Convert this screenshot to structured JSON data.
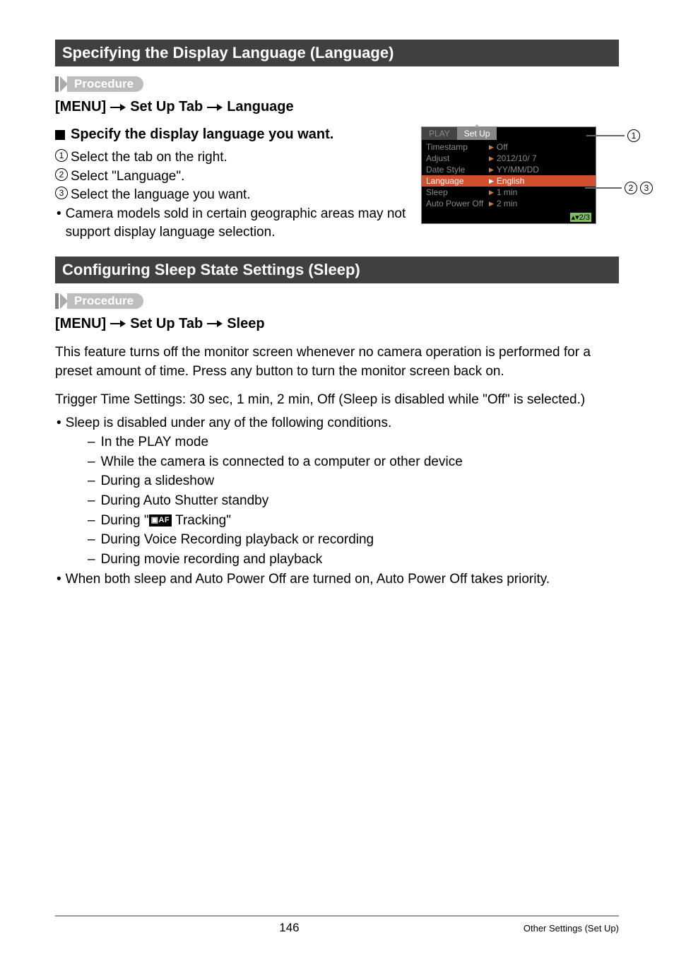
{
  "section1": {
    "title": "Specifying the Display Language (Language)",
    "procedure_label": "Procedure",
    "menu_path": {
      "a": "[MENU]",
      "b": "Set Up Tab",
      "c": "Language"
    },
    "subheading": "Specify the display language you want.",
    "steps": {
      "s1": "Select the tab on the right.",
      "s2": "Select \"Language\".",
      "s3": "Select the language you want."
    },
    "note": "Camera models sold in certain geographic areas may not support display language selection."
  },
  "camera": {
    "tab_play": "PLAY",
    "tab_setup": "Set Up",
    "rows": [
      {
        "k": "Timestamp",
        "v": "Off"
      },
      {
        "k": "Adjust",
        "v": "2012/10/ 7"
      },
      {
        "k": "Date Style",
        "v": "YY/MM/DD"
      },
      {
        "k": "Language",
        "v": "English",
        "hl": true
      },
      {
        "k": "Sleep",
        "v": "1 min"
      },
      {
        "k": "Auto Power Off",
        "v": "2 min"
      }
    ],
    "footer": "▴▾2/3",
    "callouts": {
      "c1": "1",
      "c2": "2",
      "c3": "3"
    }
  },
  "section2": {
    "title": "Configuring Sleep State Settings (Sleep)",
    "procedure_label": "Procedure",
    "menu_path": {
      "a": "[MENU]",
      "b": "Set Up Tab",
      "c": "Sleep"
    },
    "para1": "This feature turns off the monitor screen whenever no camera operation is performed for a preset amount of time. Press any button to turn the monitor screen back on.",
    "para2": "Trigger Time Settings: 30 sec, 1 min, 2 min, Off (Sleep is disabled while \"Off\" is selected.)",
    "bullet1": "Sleep is disabled under any of the following conditions.",
    "dashes": {
      "d1": "In the PLAY mode",
      "d2": "While the camera is connected to a computer or other device",
      "d3": "During a slideshow",
      "d4": "During Auto Shutter standby",
      "d5a": "During \"",
      "d5_icon": "▣AF",
      "d5b": " Tracking\"",
      "d6": "During Voice Recording playback or recording",
      "d7": "During movie recording and playback"
    },
    "bullet2": "When both sleep and Auto Power Off are turned on, Auto Power Off takes priority."
  },
  "footer": {
    "page": "146",
    "section": "Other Settings (Set Up)"
  }
}
